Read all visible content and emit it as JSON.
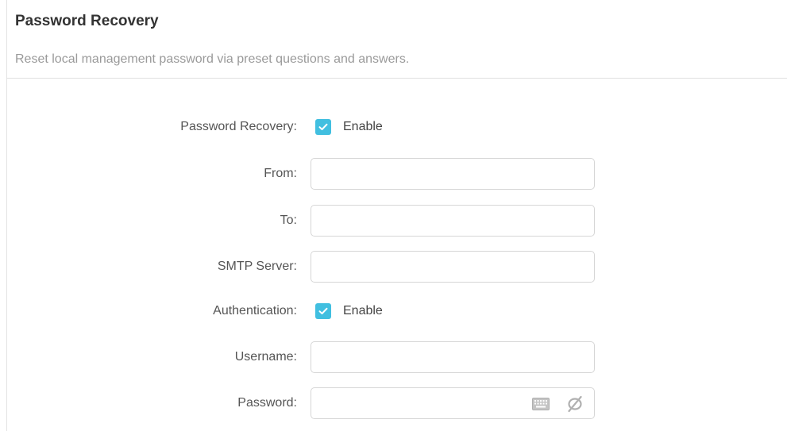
{
  "header": {
    "title": "Password Recovery",
    "subtitle": "Reset local management password via preset questions and answers."
  },
  "form": {
    "password_recovery": {
      "label": "Password Recovery:",
      "checkbox_label": "Enable",
      "checked": true
    },
    "from": {
      "label": "From:",
      "value": ""
    },
    "to": {
      "label": "To:",
      "value": ""
    },
    "smtp_server": {
      "label": "SMTP Server:",
      "value": ""
    },
    "authentication": {
      "label": "Authentication:",
      "checkbox_label": "Enable",
      "checked": true
    },
    "username": {
      "label": "Username:",
      "value": ""
    },
    "password": {
      "label": "Password:",
      "value": ""
    }
  },
  "icons": {
    "checkbox_check": "check-icon",
    "keyboard": "keyboard-icon",
    "visibility": "eye-slash-icon"
  },
  "colors": {
    "accent": "#41bfe0",
    "icon_gray": "#b0b0b0"
  }
}
